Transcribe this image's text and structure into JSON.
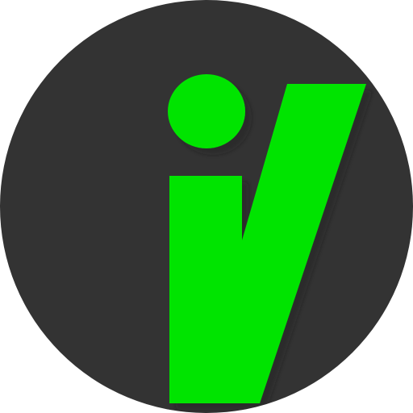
{
  "logo": {
    "icon_name": "iv-logo-icon",
    "colors": {
      "background_circle": "#333333",
      "accent": "#00E400",
      "shadow": "#1f1f1f"
    }
  }
}
